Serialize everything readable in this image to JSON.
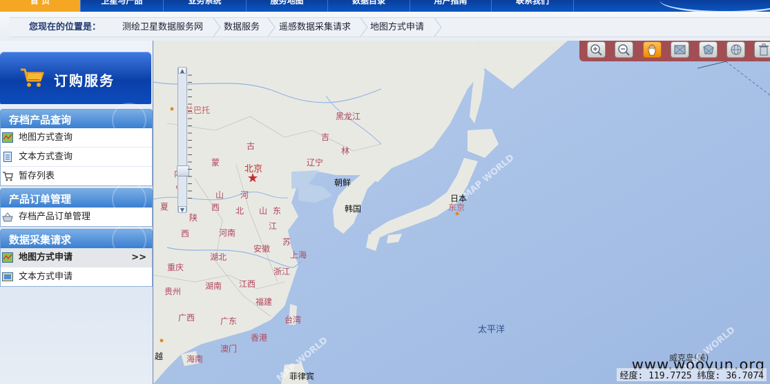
{
  "nav": {
    "tabs": [
      {
        "label": "首 页"
      },
      {
        "label": "卫星与产品"
      },
      {
        "label": "业务系统"
      },
      {
        "label": "服务地图"
      },
      {
        "label": "数据目录"
      },
      {
        "label": "用户指南"
      },
      {
        "label": "联系我们"
      }
    ]
  },
  "breadcrumb": {
    "lead": "您现在的位置是：",
    "items": [
      "测绘卫星数据服务网",
      "数据服务",
      "遥感数据采集请求",
      "地图方式申请"
    ]
  },
  "sidebar": {
    "banner": "订购服务",
    "sections": [
      {
        "title": "存档产品查询",
        "items": [
          {
            "label": "地图方式查询",
            "icon": "map-doc-icon"
          },
          {
            "label": "文本方式查询",
            "icon": "text-doc-icon"
          },
          {
            "label": "暂存列表",
            "icon": "cart-icon"
          }
        ]
      },
      {
        "title": "产品订单管理",
        "items": [
          {
            "label": "存档产品订单管理",
            "icon": "basket-icon"
          }
        ]
      },
      {
        "title": "数据采集请求",
        "items": [
          {
            "label": "地图方式申请",
            "icon": "map-doc-icon",
            "active": true,
            "arrow": ">>"
          },
          {
            "label": "文本方式申请",
            "icon": "text-form-icon"
          }
        ]
      }
    ]
  },
  "map": {
    "labels": {
      "ulaanbaatar": "乌兰巴托",
      "heilongjiang": "黑龙江",
      "jilin1": "吉",
      "jilin2": "林",
      "liaoning": "辽宁",
      "neimeng1": "古",
      "neimeng2": "蒙",
      "beijing": "北京",
      "hebei1": "河",
      "hebei2": "北",
      "shanxi1": "山",
      "shanxi2": "西",
      "shandong1": "山",
      "shandong2": "东",
      "shaanxi1": "陕",
      "shaanxi2": "西",
      "henan": "河南",
      "jiangsu1": "江",
      "jiangsu2": "苏",
      "anhui": "安徽",
      "hubei": "湖北",
      "shanghai": "上海",
      "zhejiang": "浙江",
      "chongqing": "重庆",
      "guizhou": "贵州",
      "hunan": "湖南",
      "jiangxi": "江西",
      "fujian": "福建",
      "guangxi": "广西",
      "guangdong": "广东",
      "taiwan": "台湾",
      "hongkong": "香港",
      "macau": "澳门",
      "hainan": "海南",
      "nkorea": "朝鲜",
      "skorea": "韩国",
      "japan": "日本",
      "tokyo": "东京",
      "pacific": "太平洋",
      "philippines": "菲律宾",
      "wake": "威克岛(美)",
      "left_yue": "越",
      "left_xia": "夏",
      "left_nei": "内",
      "left_yi": "宁"
    },
    "watermark": "MAP WORLD",
    "tools": [
      {
        "icon": "zoom-in-icon"
      },
      {
        "icon": "zoom-out-icon"
      },
      {
        "icon": "pan-hand-icon",
        "active": true
      },
      {
        "icon": "rectangle-select-icon"
      },
      {
        "icon": "polygon-select-icon"
      },
      {
        "icon": "globe-icon"
      },
      {
        "icon": "trash-icon"
      }
    ],
    "zoom_level": 0.25,
    "readout": "经度: 119.7725 纬度: 36.7074",
    "site_watermark": "www.wooyun.org"
  },
  "colors": {
    "nav_blue": "#0b4fb8",
    "active_tab": "#f5a623",
    "sea": "#a9c2e6",
    "land": "#e8e8e2",
    "toolbar": "#a24e53"
  }
}
